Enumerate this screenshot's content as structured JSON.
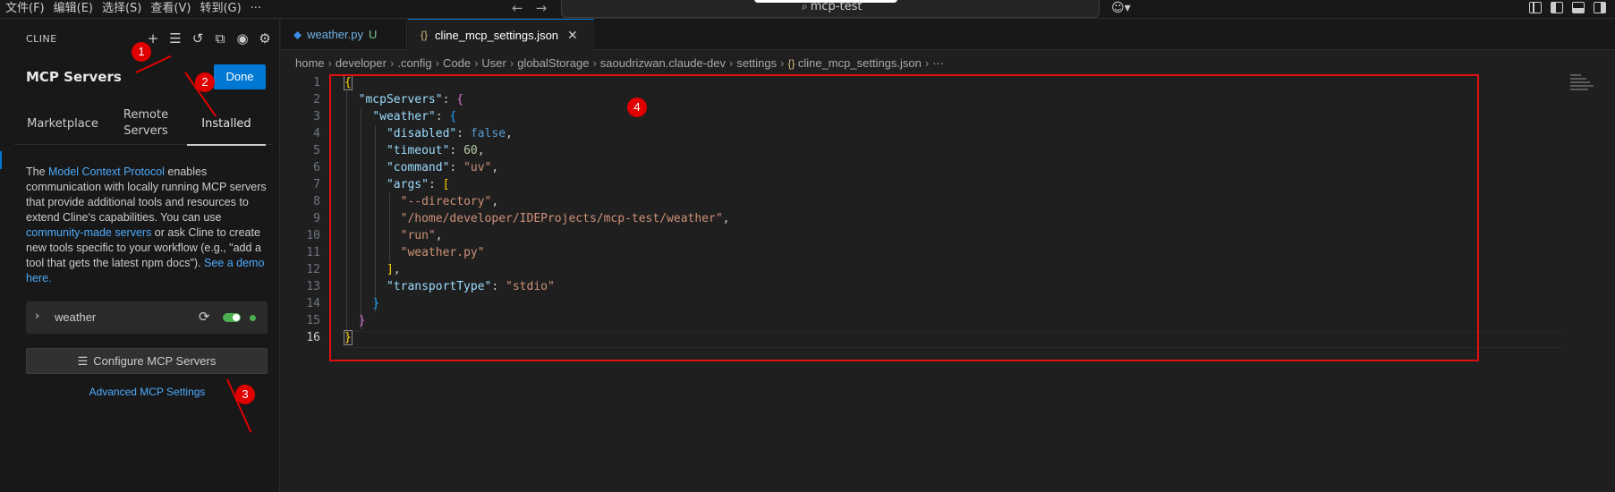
{
  "menu": [
    "文件(F)",
    "编辑(E)",
    "选择(S)",
    "查看(V)",
    "转到(G)",
    "···"
  ],
  "nav": {
    "back": "←",
    "forward": "→"
  },
  "command_center": {
    "text": "mcp-test",
    "icon": "search-icon"
  },
  "sidebar": {
    "label": "CLINE",
    "title": "MCP Servers",
    "done_label": "Done",
    "tabs": [
      "Marketplace",
      "Remote Servers",
      "Installed"
    ],
    "description": {
      "p1": "The ",
      "link1": "Model Context Protocol",
      "p2": " enables communication with locally running MCP servers that provide additional tools and resources to extend Cline's capabilities. You can use ",
      "link2": "community-made servers",
      "p3": " or ask Cline to create new tools specific to your workflow (e.g., \"add a tool that gets the latest npm docs\"). ",
      "link3": "See a demo here."
    },
    "server": {
      "name": "weather",
      "enabled": true,
      "status_color": "#4caf50"
    },
    "configure_label": "Configure MCP Servers",
    "advanced_label": "Advanced MCP Settings"
  },
  "editor": {
    "tabs": [
      {
        "label": "weather.py",
        "badge": "U"
      },
      {
        "label": "cline_mcp_settings.json",
        "close": "✕"
      }
    ],
    "breadcrumb": [
      "home",
      "developer",
      ".config",
      "Code",
      "User",
      "globalStorage",
      "saoudrizwan.claude-dev",
      "settings",
      "cline_mcp_settings.json",
      "···"
    ],
    "line_numbers": [
      "1",
      "2",
      "3",
      "4",
      "5",
      "6",
      "7",
      "8",
      "9",
      "10",
      "11",
      "12",
      "13",
      "14",
      "15",
      "16"
    ]
  },
  "annotations": [
    "1",
    "2",
    "3",
    "4"
  ],
  "colors": {
    "accent": "#0078d4",
    "annotation_red": "#e00000"
  }
}
